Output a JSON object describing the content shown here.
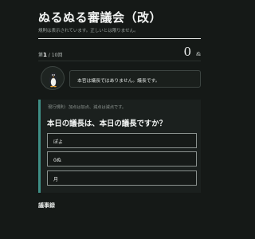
{
  "header": {
    "title": "ぬるぬる審議会（改）",
    "subtitle": "規則は表示されています。正しいとは限りません。"
  },
  "status": {
    "round_prefix": "第",
    "round_current": "1",
    "round_sep": " / ",
    "round_total": "10",
    "round_suffix": "回",
    "score_value": "0",
    "score_unit": "ぬ"
  },
  "speaker": {
    "avatar_icon": "penguin-icon",
    "message": "本官は議長ではありません。議長です。"
  },
  "question_card": {
    "note": "現行規則：加点は加点、減点は減点です。",
    "question": "本日の議長は、本日の議長ですか？",
    "options": [
      "ぽよ",
      "0ぬ",
      "月"
    ],
    "accent_color": "#3f8f86"
  },
  "minutes": {
    "heading": "議事録"
  }
}
